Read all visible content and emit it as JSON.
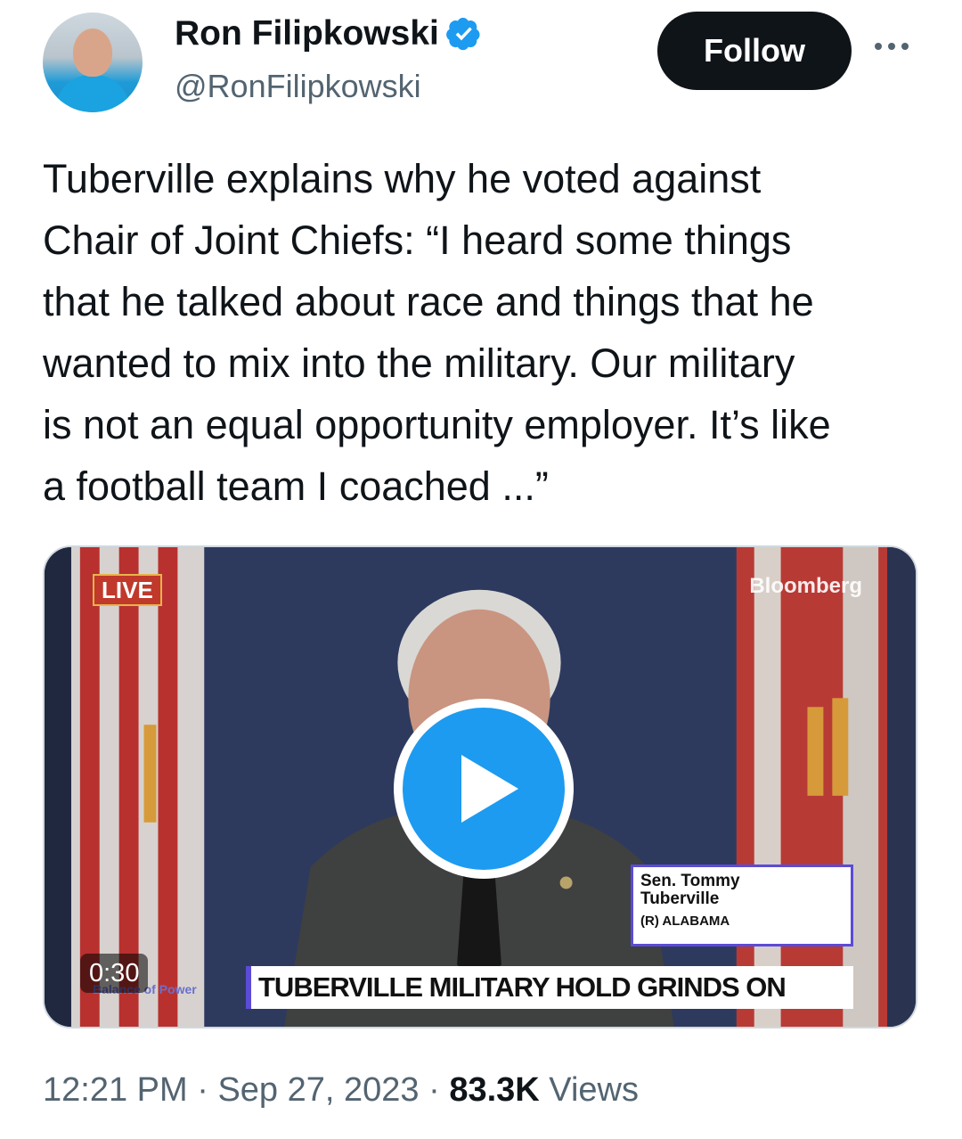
{
  "author": {
    "name": "Ron Filipkowski",
    "handle": "@RonFilipkowski",
    "verified": true
  },
  "actions": {
    "follow_label": "Follow"
  },
  "tweet": {
    "text": "Tuberville explains why he voted against\nChair of Joint Chiefs: “I heard some things\nthat he talked about race and things that he\nwanted to mix into the military. Our military\nis not an equal opportunity employer. It’s like\na football team I coached ...”"
  },
  "video": {
    "live_badge": "LIVE",
    "network": "Bloomberg",
    "nameplate_line1": "Sen. Tommy",
    "nameplate_line2": "Tuberville",
    "nameplate_line3": "(R) ALABAMA",
    "show_name": "Balance of Power",
    "chyron": "TUBERVILLE MILITARY HOLD GRINDS ON",
    "duration": "0:30"
  },
  "meta": {
    "time": "12:21 PM",
    "separator": "·",
    "date": "Sep 27, 2023",
    "views_count": "83.3K",
    "views_label": "Views"
  },
  "colors": {
    "accent": "#1d9bf0",
    "text_primary": "#0f1419",
    "text_secondary": "#536471"
  },
  "icons": {
    "verified": "verified-badge-icon",
    "more": "more-dots-icon",
    "play": "play-icon"
  }
}
